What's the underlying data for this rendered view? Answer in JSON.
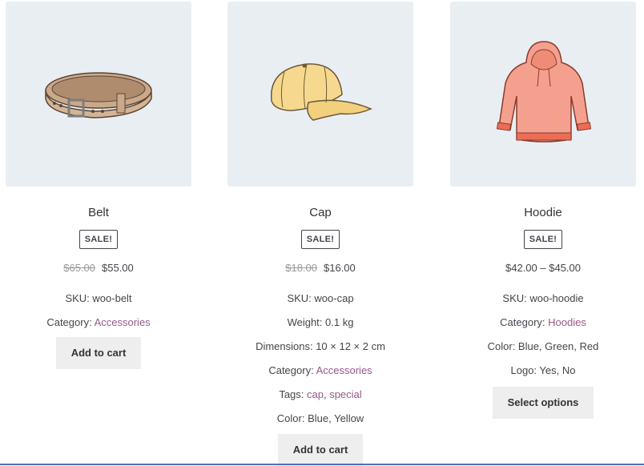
{
  "products": [
    {
      "title": "Belt",
      "badge": "SALE!",
      "regular_price": "$65.00",
      "sale_price": "$55.00",
      "sku_label": "SKU: ",
      "sku": "woo-belt",
      "category_label": "Category: ",
      "category": "Accessories",
      "button": "Add to cart",
      "image_icon": "belt-icon"
    },
    {
      "title": "Cap",
      "badge": "SALE!",
      "regular_price": "$18.00",
      "sale_price": "$16.00",
      "sku_label": "SKU: ",
      "sku": "woo-cap",
      "weight": "Weight: 0.1 kg",
      "dimensions": "Dimensions: 10 × 12 × 2 cm",
      "category_label": "Category: ",
      "category": "Accessories",
      "tags_label": "Tags: ",
      "tag1": "cap",
      "tag_sep": ", ",
      "tag2": "special",
      "color": "Color: Blue, Yellow",
      "button": "Add to cart",
      "image_icon": "cap-icon"
    },
    {
      "title": "Hoodie",
      "badge": "SALE!",
      "price_range": "$42.00 – $45.00",
      "sku_label": "SKU: ",
      "sku": "woo-hoodie",
      "category_label": "Category: ",
      "category": "Hoodies",
      "color": "Color: Blue, Green, Red",
      "logo": "Logo: Yes, No",
      "button": "Select options",
      "image_icon": "hoodie-icon"
    }
  ],
  "colors": {
    "link": "#96588a",
    "thumb_bg": "#e9eef3",
    "button_bg": "#eeeeee"
  }
}
